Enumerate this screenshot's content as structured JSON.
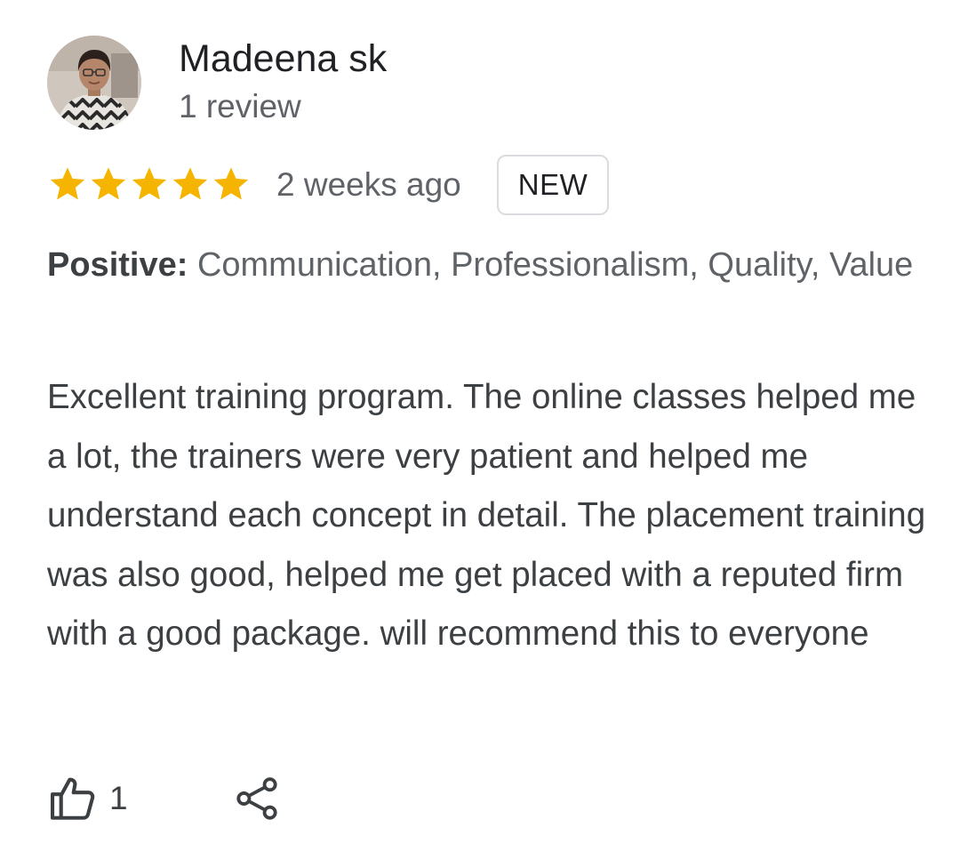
{
  "review": {
    "author": {
      "name": "Madeena sk",
      "review_count": "1 review",
      "avatar_icon": "user-avatar-photo"
    },
    "rating": 5,
    "max_rating": 5,
    "time": "2 weeks ago",
    "badge": "NEW",
    "attributes": {
      "label": "Positive:",
      "values": "Communication, Professionalism, Quality, Value"
    },
    "text": "Excellent training program. The online classes helped me a lot, the trainers were very patient and helped me understand each concept in detail. The placement training was also good, helped me get placed with a reputed firm with a good package. will recommend this to everyone",
    "actions": {
      "like_icon": "thumbs-up-icon",
      "like_count": "1",
      "share_icon": "share-icon"
    }
  },
  "colors": {
    "star": "#F5B400",
    "primary_text": "#202124",
    "secondary_text": "#5f6368",
    "body_text": "#3c4043",
    "badge_border": "#dadce0"
  }
}
